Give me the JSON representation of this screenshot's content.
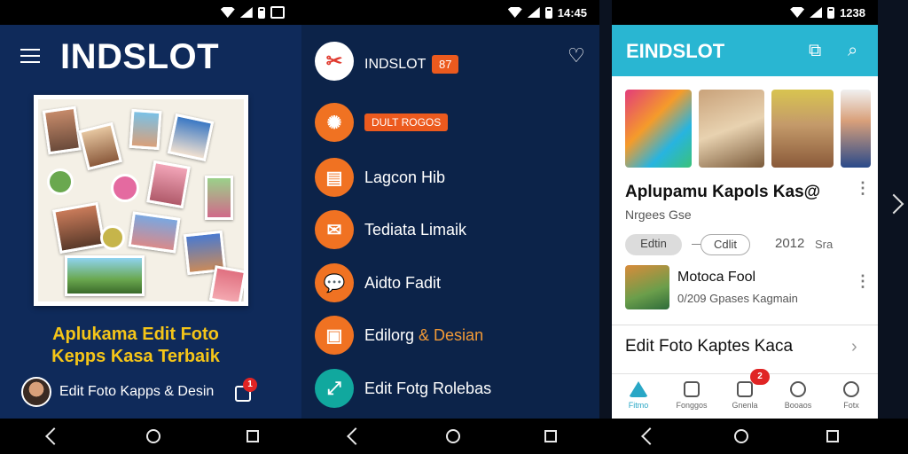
{
  "status": {
    "left_time": "14:45",
    "right_time": "1238"
  },
  "panel1": {
    "brand": "INDSLOT",
    "headline_line1": "Aplukama Edit Foto",
    "headline_line2": "Kepps Kasa Terbaik",
    "bottom_label": "Edit Foto Kapps & Desin",
    "bag_badge": "1"
  },
  "panel2": {
    "title": "INDSLOT",
    "title_tag": "87",
    "top_tag": "DULT ROGOS",
    "items": [
      {
        "label": "Lagcon Hib"
      },
      {
        "label": "Tediata Limaik"
      },
      {
        "label": "Aidto Fadit"
      },
      {
        "label_a": "Edilorg",
        "label_sep": " & ",
        "label_b": "Desian"
      },
      {
        "label": "Edit Fotg Rolebas"
      }
    ],
    "icons": [
      "gear-icon",
      "document-icon",
      "mail-icon",
      "chat-icon",
      "image-icon",
      "crop-icon"
    ]
  },
  "panel3": {
    "app_title": "EINDSLOT",
    "card_title": "Aplupamu Kapols Kas@",
    "card_sub": "Nrgees Gse",
    "chip1": "Edtin",
    "chip2": "Cdlit",
    "year": "2012",
    "year_suffix": "Sra",
    "list_title": "Motoca Fool",
    "list_sub": "0/209 Gpases Kagmain",
    "section_title": "Edit Foto Kaptes Kaca",
    "nav": [
      {
        "label": "Fitmo"
      },
      {
        "label": "Fonggos"
      },
      {
        "label": "Gnenla"
      },
      {
        "label": "Booaos"
      },
      {
        "label": "Fotx"
      }
    ],
    "nav_badge": "2"
  }
}
